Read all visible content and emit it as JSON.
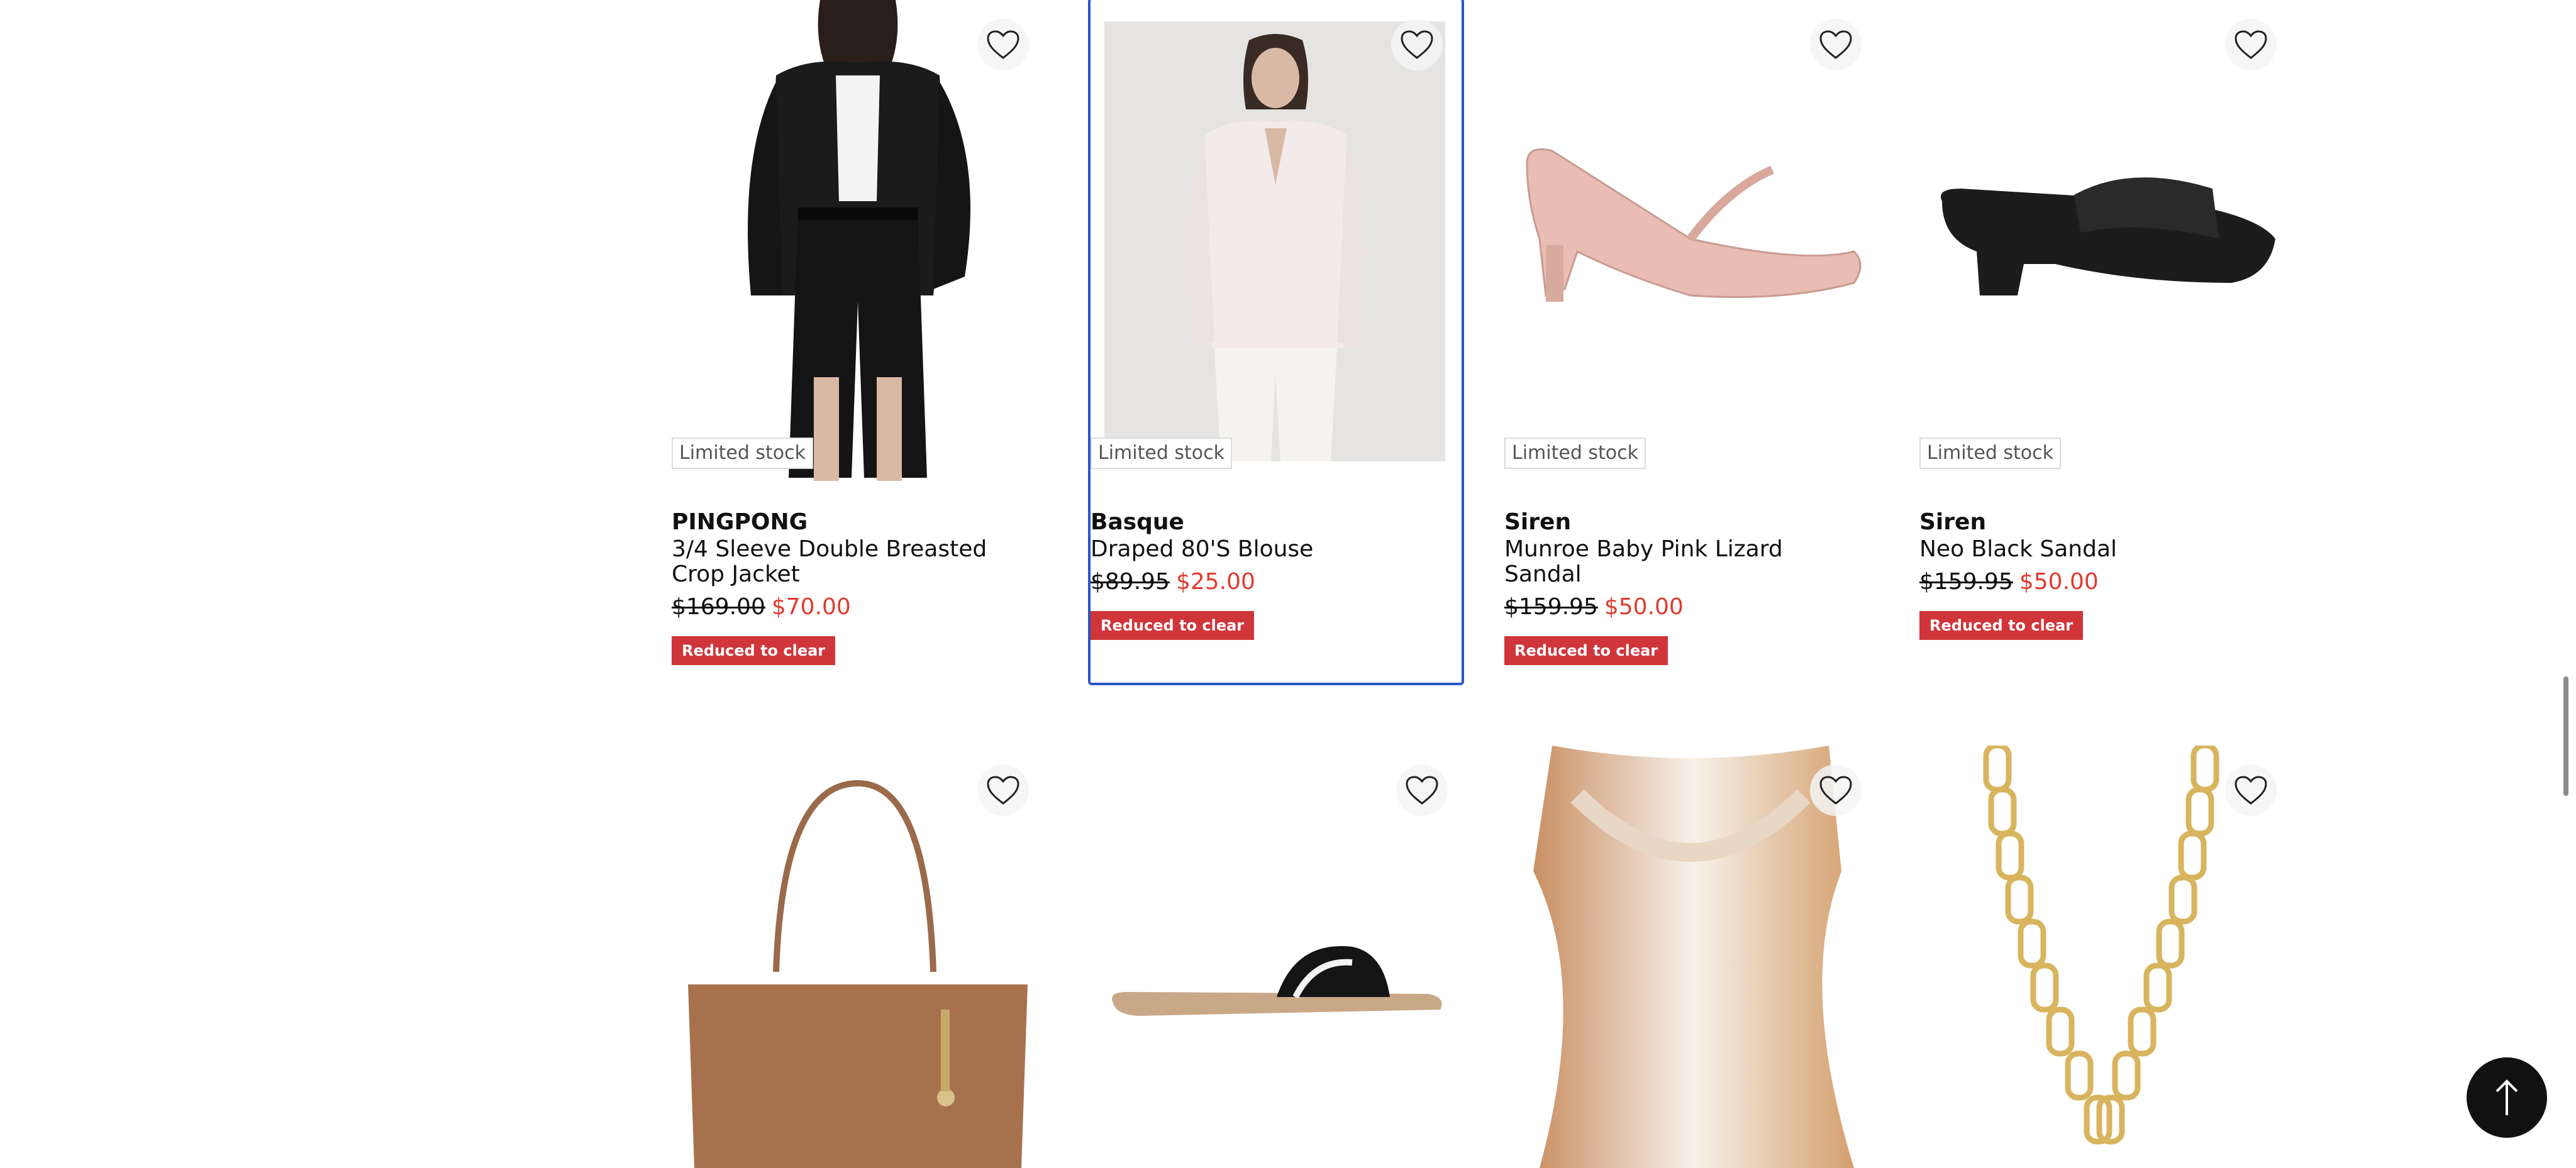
{
  "products_row1": [
    {
      "brand": "PINGPONG",
      "name": "3/4 Sleeve Double Breasted Crop Jacket",
      "was": "$169.00",
      "now": "$70.00",
      "stock": "Limited stock",
      "badge": "Reduced to clear"
    },
    {
      "brand": "Basque",
      "name": "Draped 80'S Blouse",
      "was": "$89.95",
      "now": "$25.00",
      "stock": "Limited stock",
      "badge": "Reduced to clear"
    },
    {
      "brand": "Siren",
      "name": "Munroe Baby Pink Lizard Sandal",
      "was": "$159.95",
      "now": "$50.00",
      "stock": "Limited stock",
      "badge": "Reduced to clear"
    },
    {
      "brand": "Siren",
      "name": "Neo Black Sandal",
      "was": "$159.95",
      "now": "$50.00",
      "stock": "Limited stock",
      "badge": "Reduced to clear"
    }
  ],
  "icons": {
    "wishlist": "heart-outline-icon",
    "scroll_top": "arrow-up-icon"
  },
  "colors": {
    "sale": "#e03b2e",
    "badge": "#d0353a",
    "selected_border": "#2a56c6"
  }
}
